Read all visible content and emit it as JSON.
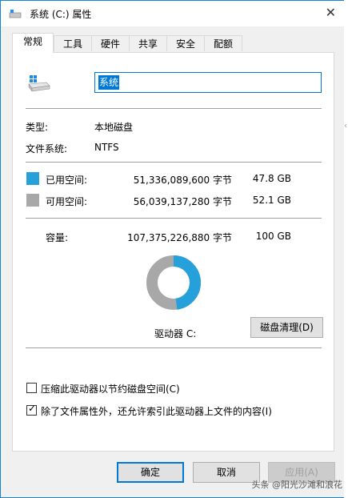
{
  "window": {
    "title": "系统 (C:) 属性"
  },
  "tabs": [
    {
      "label": "常规"
    },
    {
      "label": "工具"
    },
    {
      "label": "硬件"
    },
    {
      "label": "共享"
    },
    {
      "label": "安全"
    },
    {
      "label": "配额"
    }
  ],
  "general": {
    "name_value": "系统",
    "type_label": "类型:",
    "type_value": "本地磁盘",
    "fs_label": "文件系统:",
    "fs_value": "NTFS",
    "used": {
      "label": "已用空间:",
      "bytes": "51,336,089,600 字节",
      "human": "47.8 GB",
      "color": "#26a0da"
    },
    "free": {
      "label": "可用空间:",
      "bytes": "56,039,137,280 字节",
      "human": "52.1 GB",
      "color": "#a8a8a8"
    },
    "capacity": {
      "label": "容量:",
      "bytes": "107,375,226,880 字节",
      "human": "100 GB"
    },
    "used_fraction": 0.478,
    "drive_label": "驱动器 C:",
    "cleanup_button": "磁盘清理(D)",
    "compress_label": "压缩此驱动器以节约磁盘空间(C)",
    "compress_checked": false,
    "index_label": "除了文件属性外，还允许索引此驱动器上文件的内容(I)",
    "index_checked": true
  },
  "footer": {
    "ok": "确定",
    "cancel": "取消",
    "apply": "应用(A)"
  },
  "watermark": "头条 @阳光沙滩和浪花"
}
